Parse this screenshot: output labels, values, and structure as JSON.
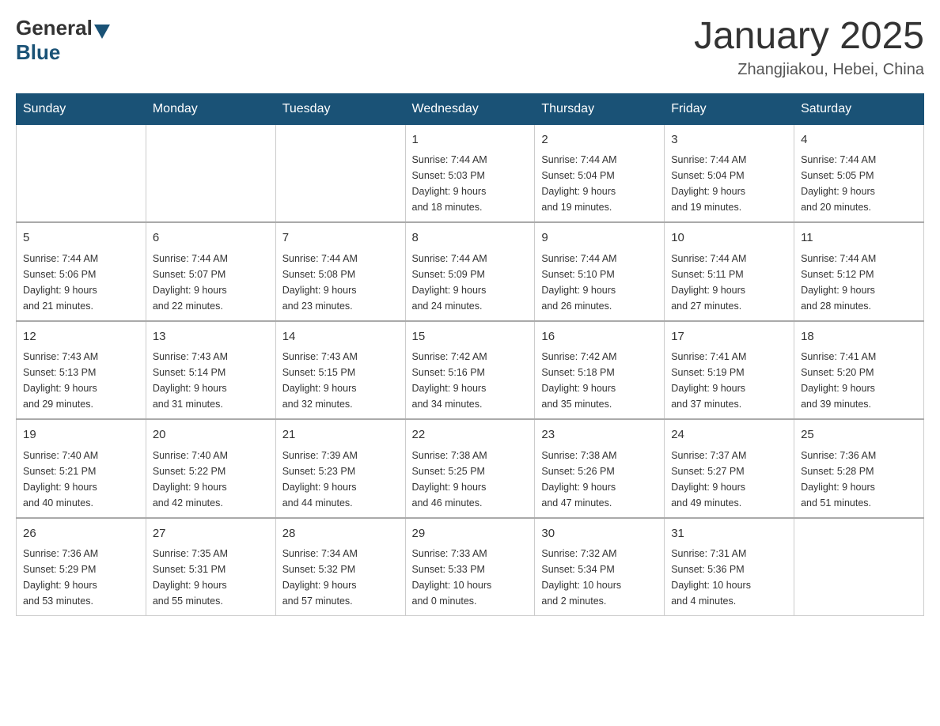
{
  "header": {
    "logo_general": "General",
    "logo_blue": "Blue",
    "month_title": "January 2025",
    "location": "Zhangjiakou, Hebei, China"
  },
  "days_of_week": [
    "Sunday",
    "Monday",
    "Tuesday",
    "Wednesday",
    "Thursday",
    "Friday",
    "Saturday"
  ],
  "weeks": [
    [
      {
        "day": "",
        "info": ""
      },
      {
        "day": "",
        "info": ""
      },
      {
        "day": "",
        "info": ""
      },
      {
        "day": "1",
        "info": "Sunrise: 7:44 AM\nSunset: 5:03 PM\nDaylight: 9 hours\nand 18 minutes."
      },
      {
        "day": "2",
        "info": "Sunrise: 7:44 AM\nSunset: 5:04 PM\nDaylight: 9 hours\nand 19 minutes."
      },
      {
        "day": "3",
        "info": "Sunrise: 7:44 AM\nSunset: 5:04 PM\nDaylight: 9 hours\nand 19 minutes."
      },
      {
        "day": "4",
        "info": "Sunrise: 7:44 AM\nSunset: 5:05 PM\nDaylight: 9 hours\nand 20 minutes."
      }
    ],
    [
      {
        "day": "5",
        "info": "Sunrise: 7:44 AM\nSunset: 5:06 PM\nDaylight: 9 hours\nand 21 minutes."
      },
      {
        "day": "6",
        "info": "Sunrise: 7:44 AM\nSunset: 5:07 PM\nDaylight: 9 hours\nand 22 minutes."
      },
      {
        "day": "7",
        "info": "Sunrise: 7:44 AM\nSunset: 5:08 PM\nDaylight: 9 hours\nand 23 minutes."
      },
      {
        "day": "8",
        "info": "Sunrise: 7:44 AM\nSunset: 5:09 PM\nDaylight: 9 hours\nand 24 minutes."
      },
      {
        "day": "9",
        "info": "Sunrise: 7:44 AM\nSunset: 5:10 PM\nDaylight: 9 hours\nand 26 minutes."
      },
      {
        "day": "10",
        "info": "Sunrise: 7:44 AM\nSunset: 5:11 PM\nDaylight: 9 hours\nand 27 minutes."
      },
      {
        "day": "11",
        "info": "Sunrise: 7:44 AM\nSunset: 5:12 PM\nDaylight: 9 hours\nand 28 minutes."
      }
    ],
    [
      {
        "day": "12",
        "info": "Sunrise: 7:43 AM\nSunset: 5:13 PM\nDaylight: 9 hours\nand 29 minutes."
      },
      {
        "day": "13",
        "info": "Sunrise: 7:43 AM\nSunset: 5:14 PM\nDaylight: 9 hours\nand 31 minutes."
      },
      {
        "day": "14",
        "info": "Sunrise: 7:43 AM\nSunset: 5:15 PM\nDaylight: 9 hours\nand 32 minutes."
      },
      {
        "day": "15",
        "info": "Sunrise: 7:42 AM\nSunset: 5:16 PM\nDaylight: 9 hours\nand 34 minutes."
      },
      {
        "day": "16",
        "info": "Sunrise: 7:42 AM\nSunset: 5:18 PM\nDaylight: 9 hours\nand 35 minutes."
      },
      {
        "day": "17",
        "info": "Sunrise: 7:41 AM\nSunset: 5:19 PM\nDaylight: 9 hours\nand 37 minutes."
      },
      {
        "day": "18",
        "info": "Sunrise: 7:41 AM\nSunset: 5:20 PM\nDaylight: 9 hours\nand 39 minutes."
      }
    ],
    [
      {
        "day": "19",
        "info": "Sunrise: 7:40 AM\nSunset: 5:21 PM\nDaylight: 9 hours\nand 40 minutes."
      },
      {
        "day": "20",
        "info": "Sunrise: 7:40 AM\nSunset: 5:22 PM\nDaylight: 9 hours\nand 42 minutes."
      },
      {
        "day": "21",
        "info": "Sunrise: 7:39 AM\nSunset: 5:23 PM\nDaylight: 9 hours\nand 44 minutes."
      },
      {
        "day": "22",
        "info": "Sunrise: 7:38 AM\nSunset: 5:25 PM\nDaylight: 9 hours\nand 46 minutes."
      },
      {
        "day": "23",
        "info": "Sunrise: 7:38 AM\nSunset: 5:26 PM\nDaylight: 9 hours\nand 47 minutes."
      },
      {
        "day": "24",
        "info": "Sunrise: 7:37 AM\nSunset: 5:27 PM\nDaylight: 9 hours\nand 49 minutes."
      },
      {
        "day": "25",
        "info": "Sunrise: 7:36 AM\nSunset: 5:28 PM\nDaylight: 9 hours\nand 51 minutes."
      }
    ],
    [
      {
        "day": "26",
        "info": "Sunrise: 7:36 AM\nSunset: 5:29 PM\nDaylight: 9 hours\nand 53 minutes."
      },
      {
        "day": "27",
        "info": "Sunrise: 7:35 AM\nSunset: 5:31 PM\nDaylight: 9 hours\nand 55 minutes."
      },
      {
        "day": "28",
        "info": "Sunrise: 7:34 AM\nSunset: 5:32 PM\nDaylight: 9 hours\nand 57 minutes."
      },
      {
        "day": "29",
        "info": "Sunrise: 7:33 AM\nSunset: 5:33 PM\nDaylight: 10 hours\nand 0 minutes."
      },
      {
        "day": "30",
        "info": "Sunrise: 7:32 AM\nSunset: 5:34 PM\nDaylight: 10 hours\nand 2 minutes."
      },
      {
        "day": "31",
        "info": "Sunrise: 7:31 AM\nSunset: 5:36 PM\nDaylight: 10 hours\nand 4 minutes."
      },
      {
        "day": "",
        "info": ""
      }
    ]
  ]
}
